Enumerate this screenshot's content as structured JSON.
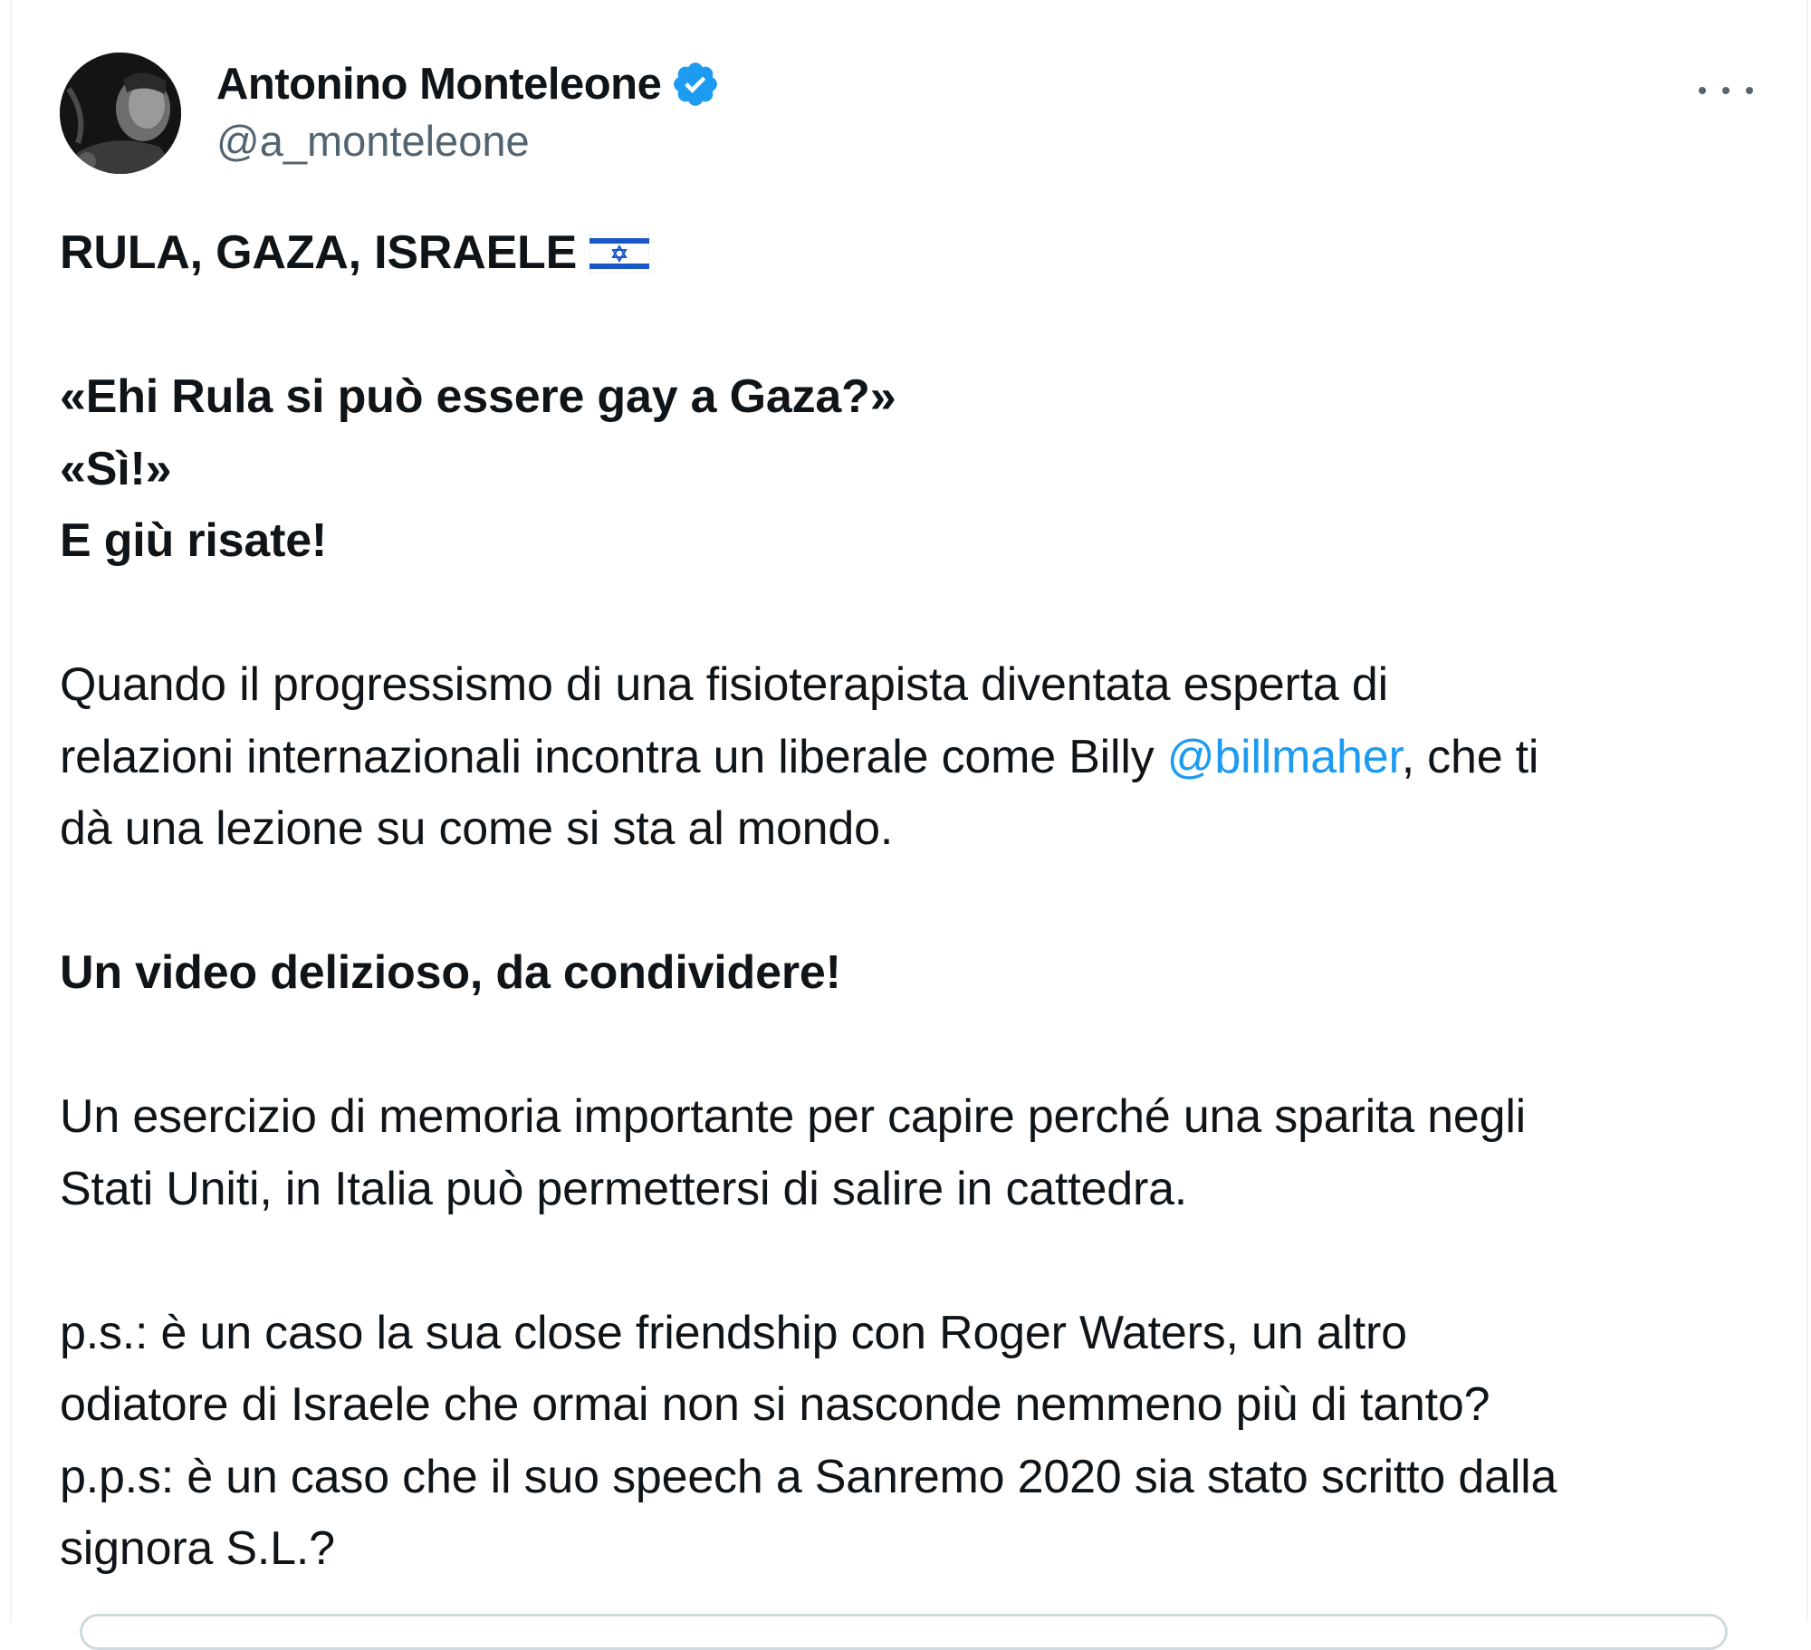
{
  "author": {
    "display_name": "Antonino Monteleone",
    "handle": "@a_monteleone",
    "verified_icon": "verified-badge-icon",
    "avatar_icon": "profile-photo"
  },
  "menu": {
    "more_icon": "more-options-icon"
  },
  "tweet": {
    "l1": "RULA, GAZA, ISRAELE",
    "flag_icon": "israel-flag-icon",
    "l2": "«Ehi Rula si può essere gay a Gaza?»",
    "l3": "«Sì!»",
    "l4": "E giù risate!",
    "p1a": "Quando il progressismo di una fisioterapista diventata esperta di",
    "p1b_pre": "relazioni internazionali incontra un liberale come Billy ",
    "p1b_mention": "@billmaher",
    "p1b_post": ", che ti",
    "p1c": "dà una lezione su come si sta al mondo.",
    "l5": "Un video delizioso, da condividere!",
    "p2a": "Un esercizio di memoria importante per capire perché una sparita negli",
    "p2b": "Stati Uniti,  in Italia può permettersi di salire in cattedra.",
    "p3a": "p.s.: è un caso la sua close friendship con Roger Waters, un altro",
    "p3b": "odiatore di Israele che ormai non si nasconde nemmeno più di tanto?",
    "p3c": "p.p.s: è un caso che il suo speech a Sanremo 2020 sia stato scritto dalla",
    "p3d": "signora S.L.?"
  },
  "colors": {
    "text": "#0f1419",
    "secondary": "#536471",
    "link": "#1d9bf0",
    "verified": "#1d9bf0",
    "border": "#cfd9de"
  }
}
